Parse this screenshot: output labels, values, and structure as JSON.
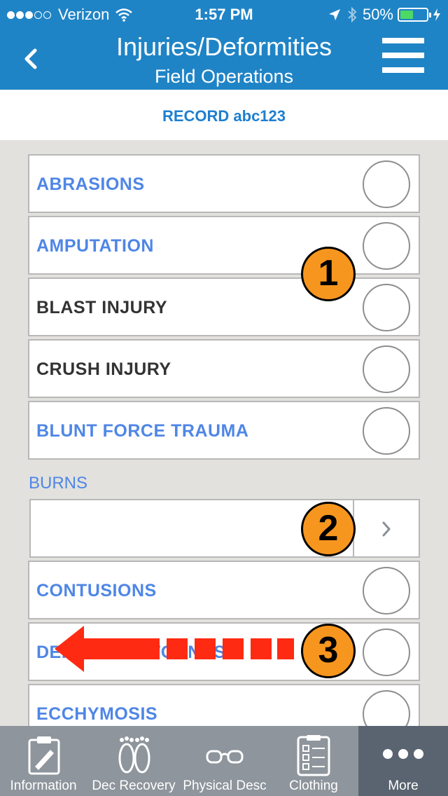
{
  "status_bar": {
    "carrier": "Verizon",
    "time": "1:57 PM",
    "battery": "50%",
    "battery_level": 0.5
  },
  "nav": {
    "title": "Injuries/Deformities",
    "subtitle": "Field Operations"
  },
  "record": {
    "label": "RECORD abc123"
  },
  "list": {
    "items_top": [
      {
        "label": "ABRASIONS",
        "color": "blue"
      },
      {
        "label": "AMPUTATION",
        "color": "blue"
      },
      {
        "label": "BLAST INJURY",
        "color": "dark"
      },
      {
        "label": "CRUSH INJURY",
        "color": "dark"
      },
      {
        "label": "BLUNT FORCE TRAUMA",
        "color": "blue"
      }
    ],
    "section_header": "BURNS",
    "items_bottom": [
      {
        "label": "CONTUSIONS",
        "color": "blue"
      },
      {
        "label": "DEFENSIVE WOUNDS",
        "color": "blue"
      },
      {
        "label": "ECCHYMOSIS",
        "color": "blue"
      }
    ]
  },
  "annotations": {
    "badge1": "1",
    "badge2": "2",
    "badge3": "3"
  },
  "tabs": [
    {
      "label": "Information",
      "icon": "clipboard-pen-icon"
    },
    {
      "label": "Dec Recovery",
      "icon": "footprints-icon"
    },
    {
      "label": "Physical Desc",
      "icon": "glasses-icon"
    },
    {
      "label": "Clothing",
      "icon": "checklist-icon"
    },
    {
      "label": "More",
      "icon": "more-dots-icon"
    }
  ],
  "colors": {
    "nav_blue": "#1f84c6",
    "label_blue": "#4f86e6",
    "badge_orange": "#f7961e",
    "arrow_red": "#ff2a12"
  }
}
